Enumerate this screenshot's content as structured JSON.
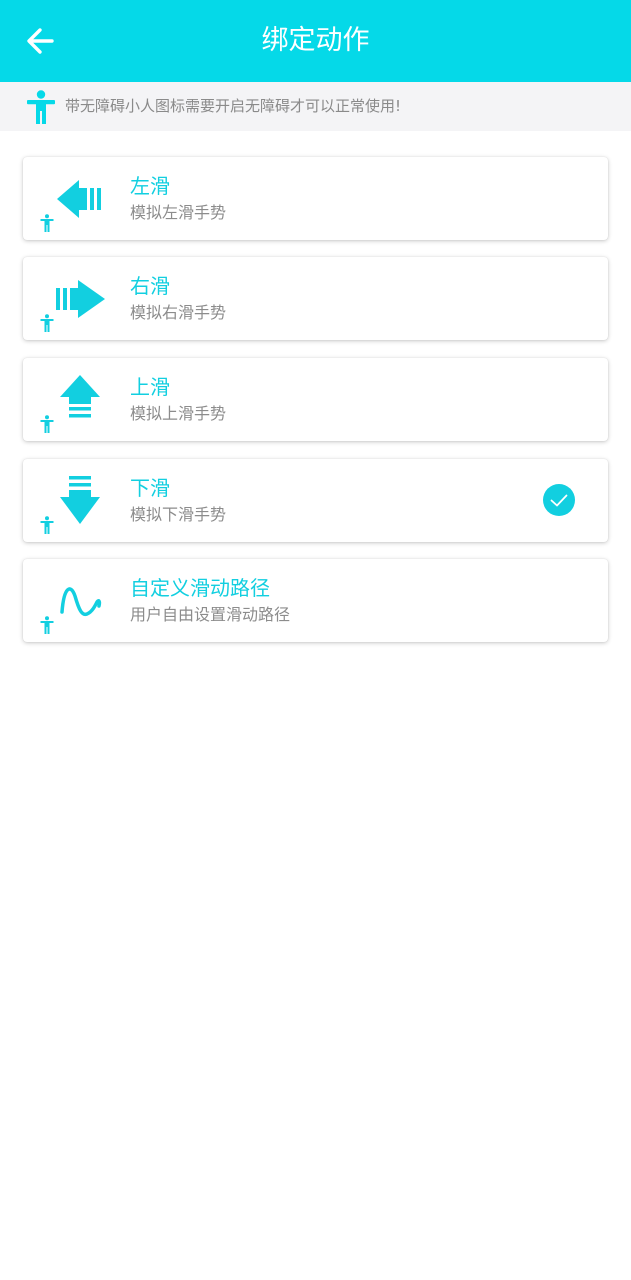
{
  "header": {
    "title": "绑定动作",
    "back_icon": "arrow-left-icon"
  },
  "notice": {
    "icon": "accessibility-person-icon",
    "text": "带无障碍小人图标需要开启无障碍才可以正常使用!"
  },
  "actions": [
    {
      "title": "左滑",
      "subtitle": "模拟左滑手势",
      "icon": "swipe-left-icon",
      "selected": false
    },
    {
      "title": "右滑",
      "subtitle": "模拟右滑手势",
      "icon": "swipe-right-icon",
      "selected": false
    },
    {
      "title": "上滑",
      "subtitle": "模拟上滑手势",
      "icon": "swipe-up-icon",
      "selected": false
    },
    {
      "title": "下滑",
      "subtitle": "模拟下滑手势",
      "icon": "swipe-down-icon",
      "selected": true
    },
    {
      "title": "自定义滑动路径",
      "subtitle": "用户自由设置滑动路径",
      "icon": "wave-path-icon",
      "selected": false
    }
  ],
  "colors": {
    "primary": "#05d9e8",
    "accent_text": "#12cfe0",
    "secondary_text": "#8c8c8c",
    "notice_bg": "#f4f4f6"
  }
}
